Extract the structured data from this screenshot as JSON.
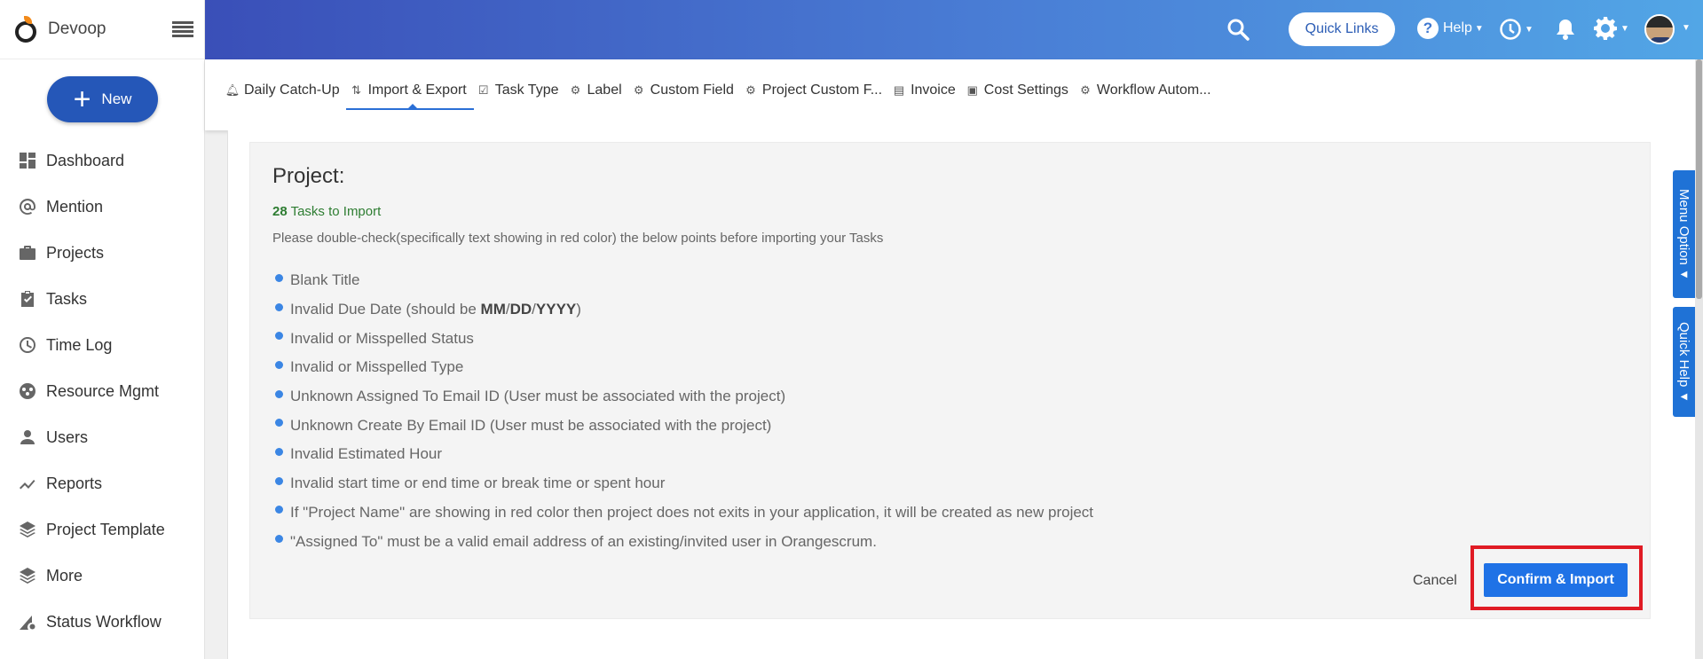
{
  "brand": {
    "name": "Devoop"
  },
  "sidebar": {
    "new_label": "New",
    "items": [
      {
        "label": "Dashboard",
        "icon": "dashboard-icon"
      },
      {
        "label": "Mention",
        "icon": "at-icon"
      },
      {
        "label": "Projects",
        "icon": "briefcase-icon"
      },
      {
        "label": "Tasks",
        "icon": "clipboard-check-icon"
      },
      {
        "label": "Time Log",
        "icon": "clock-icon"
      },
      {
        "label": "Resource Mgmt",
        "icon": "resource-icon"
      },
      {
        "label": "Users",
        "icon": "user-icon"
      },
      {
        "label": "Reports",
        "icon": "trend-icon"
      },
      {
        "label": "Project Template",
        "icon": "layers-icon"
      },
      {
        "label": "More",
        "icon": "layers-icon"
      },
      {
        "label": "Status Workflow",
        "icon": "workflow-icon"
      }
    ]
  },
  "header": {
    "quick_links": "Quick Links",
    "help": "Help"
  },
  "tabs": [
    {
      "label": "Daily Catch-Up",
      "icon": "bell-icon"
    },
    {
      "label": "Import & Export",
      "icon": "import-export-icon",
      "active": true
    },
    {
      "label": "Task Type",
      "icon": "checkbox-icon"
    },
    {
      "label": "Label",
      "icon": "gear-icon"
    },
    {
      "label": "Custom Field",
      "icon": "gear-icon"
    },
    {
      "label": "Project Custom F...",
      "icon": "gear-icon"
    },
    {
      "label": "Invoice",
      "icon": "invoice-icon"
    },
    {
      "label": "Cost Settings",
      "icon": "cost-icon"
    },
    {
      "label": "Workflow Autom...",
      "icon": "gear-icon"
    }
  ],
  "import": {
    "title": "Project:",
    "task_count": "28",
    "task_count_suffix": " Tasks to Import",
    "notice": "Please double-check(specifically text showing in red color) the below points before importing your Tasks",
    "points": [
      {
        "text": "Blank Title"
      },
      {
        "pre": "Invalid Due Date (should be ",
        "fmt1": "MM",
        "sep1": "/",
        "fmt2": "DD",
        "sep2": "/",
        "fmt3": "YYYY",
        "post": ")"
      },
      {
        "text": "Invalid or Misspelled Status"
      },
      {
        "text": "Invalid or Misspelled Type"
      },
      {
        "text": "Unknown Assigned To Email ID (User must be associated with the project)"
      },
      {
        "text": "Unknown Create By Email ID (User must be associated with the project)"
      },
      {
        "text": "Invalid Estimated Hour"
      },
      {
        "text": "Invalid start time or end time or break time or spent hour"
      },
      {
        "text": "If \"Project Name\" are showing in red color then project does not exits in your application, it will be created as new project"
      },
      {
        "text": "\"Assigned To\" must be a valid email address of an existing/invited user in Orangescrum."
      }
    ],
    "cancel": "Cancel",
    "confirm": "Confirm & Import"
  },
  "side_tabs": {
    "menu_option": "Menu Option",
    "quick_help": "Quick Help"
  },
  "colors": {
    "accent": "#1f72e6",
    "success": "#2e7d32",
    "highlight": "#e01b24"
  }
}
